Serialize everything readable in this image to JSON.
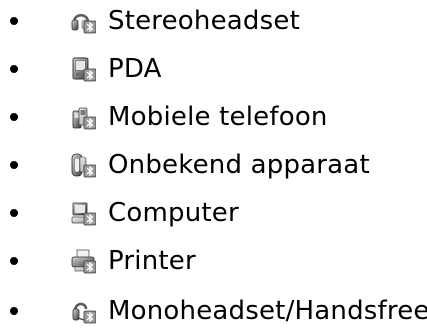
{
  "device_list": {
    "items": [
      {
        "label": "Stereoheadset",
        "icon": "stereo-headset-icon"
      },
      {
        "label": "PDA",
        "icon": "pda-icon"
      },
      {
        "label": "Mobiele telefoon",
        "icon": "mobile-phone-icon"
      },
      {
        "label": "Onbekend apparaat",
        "icon": "unknown-device-icon"
      },
      {
        "label": "Computer",
        "icon": "computer-icon"
      },
      {
        "label": "Printer",
        "icon": "printer-icon"
      },
      {
        "label": "Monoheadset/Handsfree",
        "icon": "mono-headset-icon"
      }
    ]
  }
}
